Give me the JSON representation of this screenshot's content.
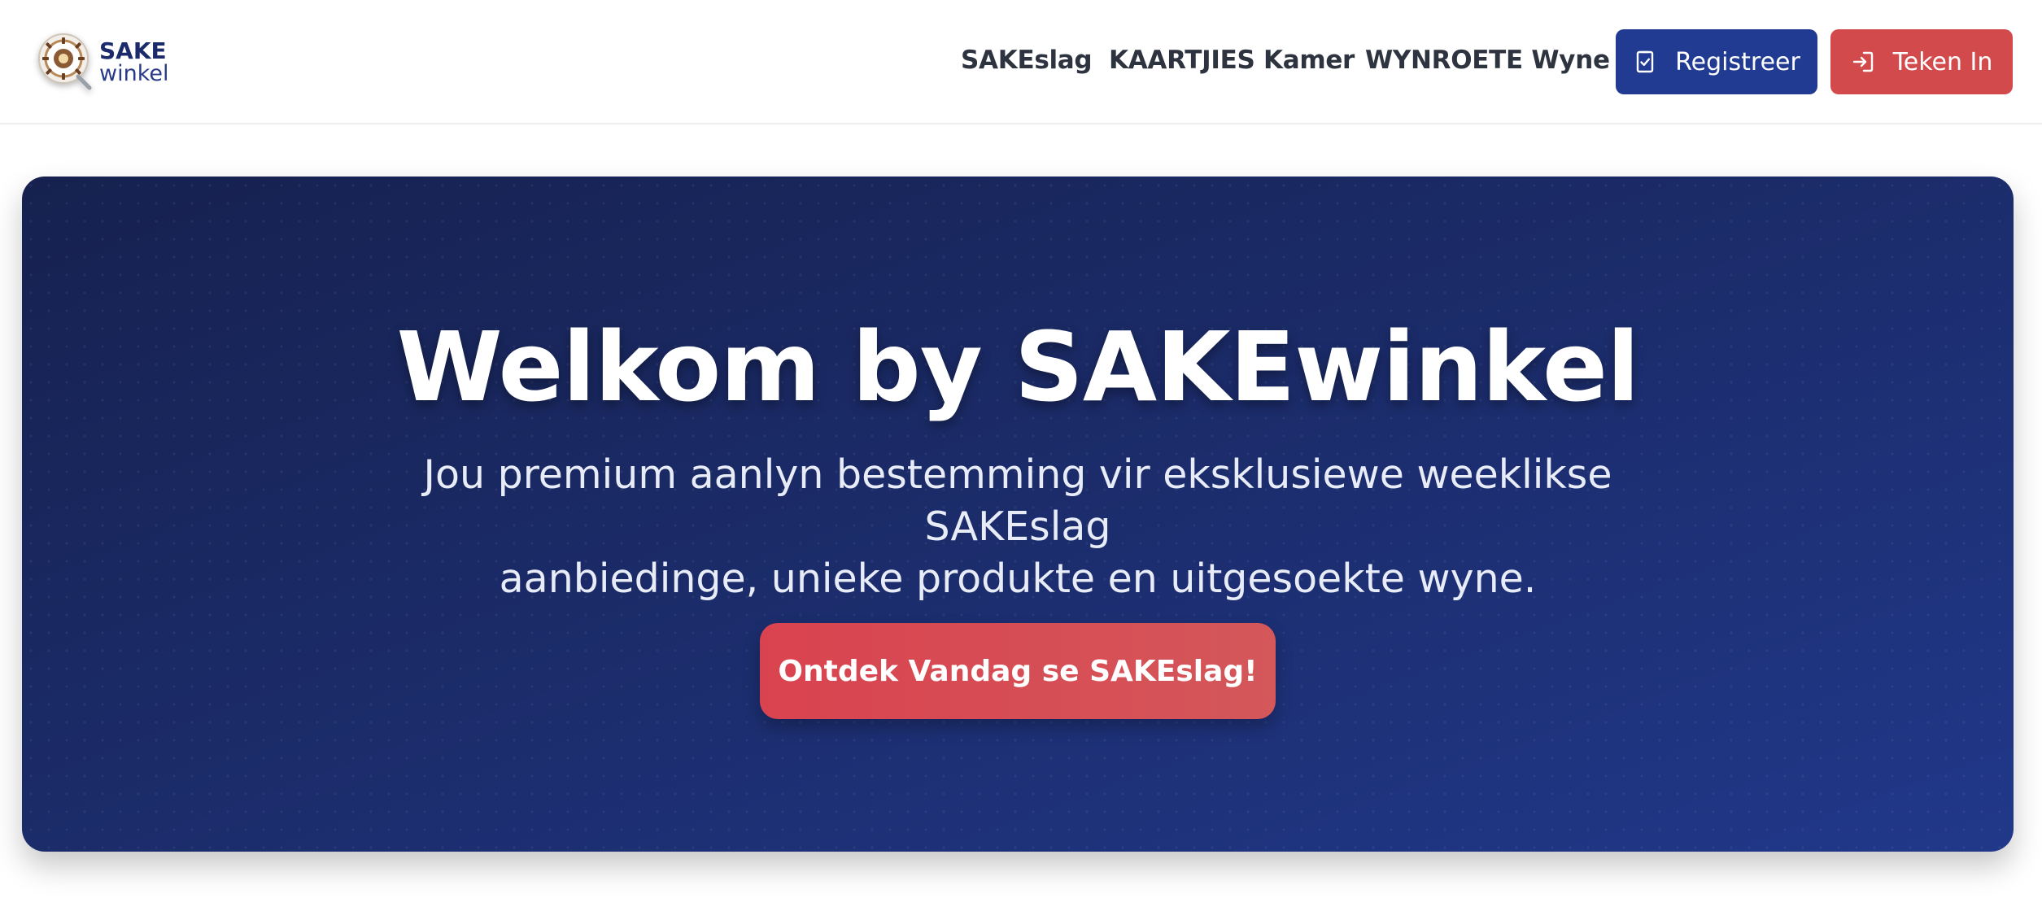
{
  "brand": {
    "name_top": "SAKE",
    "name_bottom": "winkel",
    "logo_icon": "sake-winkel-logo-icon",
    "primary_color": "#213b93",
    "accent_color": "#d24a4c"
  },
  "nav": {
    "links": [
      {
        "label": "SAKEslag"
      },
      {
        "label": "KAARTJIES Kamer"
      },
      {
        "label": "WYNROETE Wyne"
      }
    ],
    "register": {
      "label": "Registreer",
      "icon": "clipboard-check-icon"
    },
    "login": {
      "label": "Teken In",
      "icon": "sign-in-icon"
    }
  },
  "hero": {
    "title": "Welkom by SAKEwinkel",
    "subtitle_line1": "Jou premium aanlyn bestemming vir eksklusiewe weeklikse SAKEslag",
    "subtitle_line2": "aanbiedinge, unieke produkte en uitgesoekte wyne.",
    "cta_label": "Ontdek Vandag se SAKEslag!"
  }
}
